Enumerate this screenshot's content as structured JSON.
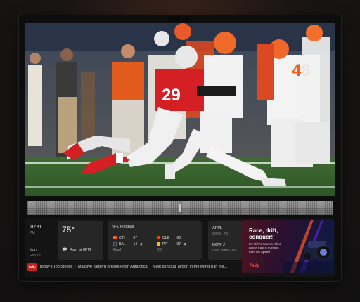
{
  "clock": {
    "time": "10:31",
    "ampm": "PM",
    "day": "Mon",
    "date": "Feb 26"
  },
  "weather": {
    "temperature": "75°",
    "condition": "Rain at 8PM",
    "icon": "rain-cloud-icon"
  },
  "sports": {
    "header": "NFL Football",
    "games": [
      {
        "teams": [
          {
            "abbr": "CIN",
            "score": "07",
            "color": "#f26522",
            "possession": ""
          },
          {
            "abbr": "BAL",
            "score": "14",
            "color": "#241773",
            "possession": "◀"
          }
        ],
        "status": "Final"
      },
      {
        "teams": [
          {
            "abbr": "CLE",
            "score": "00",
            "color": "#ff3c00",
            "possession": ""
          },
          {
            "abbr": "PIT",
            "score": "07",
            "color": "#ffb612",
            "possession": "◀"
          }
        ],
        "status": "Q3"
      }
    ]
  },
  "stocks": [
    {
      "symbol": "APPL",
      "name": "Apple, Inc."
    },
    {
      "symbol": "DOW J",
      "name": "Dow Jones Ind"
    }
  ],
  "promo": {
    "title": "Race, drift, conquer!",
    "body": "It's Telly's newest video game 'Fast & Furious: Feel the Speed'",
    "brand": "Telly"
  },
  "ticker": {
    "badge": "Telly",
    "items": [
      "Today's Top Stories",
      "Massive Iceberg Breaks From Antarctica",
      "Most punctual airport in the world is in the..."
    ]
  },
  "colors": {
    "accent": "#c8201f",
    "tile_bg": "#262626",
    "panel_bg": "#141414"
  }
}
